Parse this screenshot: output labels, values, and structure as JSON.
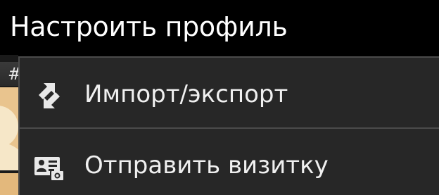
{
  "action_bar": {
    "title": "Настроить профиль"
  },
  "background_list": {
    "index_letter": "#"
  },
  "menu": {
    "items": [
      {
        "label": "Импорт/экспорт",
        "icon": "import-export-icon"
      },
      {
        "label": "Отправить визитку",
        "icon": "business-card-icon"
      }
    ]
  },
  "colors": {
    "background": "#000000",
    "menu_background": "#272727",
    "divider": "#4a4a4a",
    "text": "#f0f0f0"
  }
}
